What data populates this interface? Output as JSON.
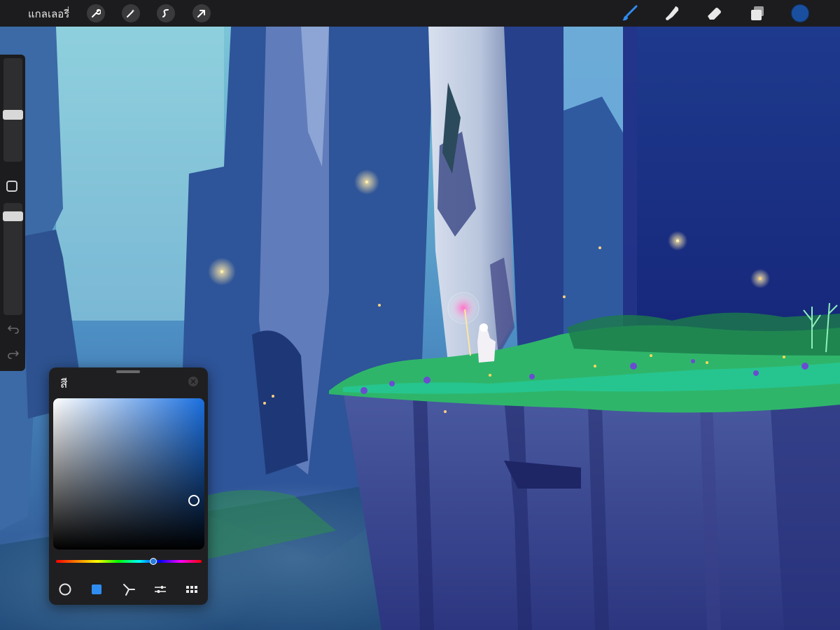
{
  "toolbar": {
    "gallery_label": "แกลเลอรี่",
    "left_tools": [
      "wrench-icon",
      "magic-wand-icon",
      "selection-icon",
      "transform-arrow-icon"
    ],
    "right_tools": [
      "brush-icon",
      "smudge-icon",
      "eraser-icon",
      "layers-icon"
    ],
    "active_tool": "brush-icon",
    "current_color": "#1a4fa0"
  },
  "sidebar": {
    "brush_size_level": 0.38,
    "opacity_level": 0.06
  },
  "color_panel": {
    "title": "สี",
    "selected_hue": "#1a6fe0",
    "hue_position": 0.66,
    "modes": [
      "disc-icon",
      "classic-icon",
      "harmony-icon",
      "value-icon",
      "palettes-icon"
    ],
    "active_mode": "classic-icon"
  },
  "colors": {
    "ui_bg": "#1c1c1e",
    "accent": "#1a6fe0",
    "canvas_sky": "#4d8fc4",
    "canvas_deep": "#16267a",
    "grass": "#2fb56a"
  }
}
